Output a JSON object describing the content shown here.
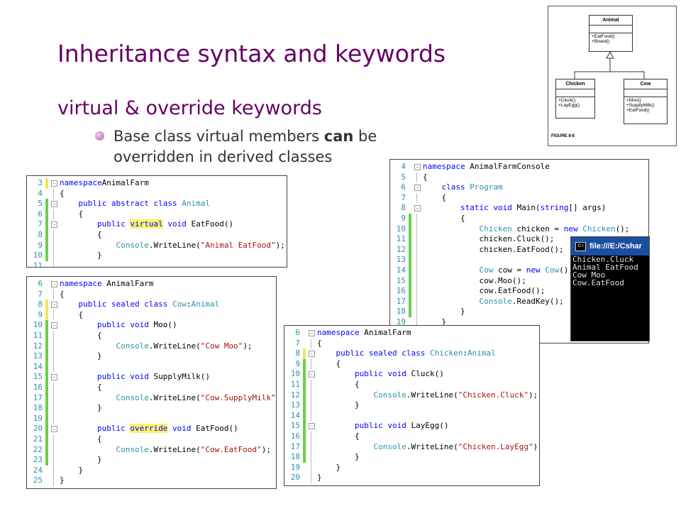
{
  "slide": {
    "title": "Inheritance syntax and keywords",
    "subtitle": "virtual & override keywords",
    "bullet_pre": "Base class virtual members ",
    "bullet_bold": "can",
    "bullet_post": " be overridden  in derived classes"
  },
  "uml": {
    "base": {
      "name": "Animal",
      "members": [
        "+EatFood()",
        "+Breed()"
      ]
    },
    "left": {
      "name": "Chicken",
      "members": [
        "+Cluck()",
        "+LayEgg()"
      ]
    },
    "right": {
      "name": "Cow",
      "members": [
        "+Moo()",
        "+SupplyMilk()",
        "+EatFood()"
      ]
    },
    "caption": "FIGURE 8-8"
  },
  "console": {
    "title": "file:///E:/Cshar",
    "icon": "C:\\",
    "lines": [
      "Chicken.Cluck",
      "Animal EatFood",
      "Cow Moo",
      "Cow.EatFood"
    ]
  },
  "snippets": [
    {
      "name": "animal-code-panel",
      "lines": [
        {
          "n": "3",
          "bar": "y",
          "fold": "-",
          "t": [
            [
              "kw",
              "namespace"
            ],
            [
              "",
              "AnimalFarm"
            ]
          ]
        },
        {
          "n": "4",
          "bar": "",
          "fold": "",
          "t": [
            [
              "",
              "{"
            ]
          ]
        },
        {
          "n": "5",
          "bar": "g",
          "fold": "-",
          "t": [
            [
              "",
              "    "
            ],
            [
              "kw",
              "public abstract class"
            ],
            [
              "",
              " "
            ],
            [
              "ty",
              "Animal"
            ]
          ]
        },
        {
          "n": "6",
          "bar": "g",
          "fold": "",
          "t": [
            [
              "",
              "    {"
            ]
          ]
        },
        {
          "n": "7",
          "bar": "g",
          "fold": "-",
          "t": [
            [
              "",
              "        "
            ],
            [
              "kw",
              "public"
            ],
            [
              "",
              " "
            ],
            [
              "kwhl",
              "virtual"
            ],
            [
              "",
              " "
            ],
            [
              "kw",
              "void"
            ],
            [
              "",
              " EatFood()"
            ]
          ]
        },
        {
          "n": "8",
          "bar": "g",
          "fold": "",
          "t": [
            [
              "",
              "        {"
            ]
          ]
        },
        {
          "n": "9",
          "bar": "g",
          "fold": "",
          "t": [
            [
              "",
              "            "
            ],
            [
              "ty",
              "Console"
            ],
            [
              "",
              ".WriteLine("
            ],
            [
              "st",
              "\"Animal EatFood\""
            ],
            [
              "",
              ");"
            ]
          ]
        },
        {
          "n": "10",
          "bar": "g",
          "fold": "",
          "t": [
            [
              "",
              "        }"
            ]
          ]
        },
        {
          "n": "11",
          "bar": "",
          "fold": "",
          "t": [
            [
              "",
              ""
            ]
          ]
        }
      ]
    },
    {
      "name": "cow-code-panel",
      "lines": [
        {
          "n": "6",
          "bar": "",
          "fold": "-",
          "t": [
            [
              "kw",
              "namespace"
            ],
            [
              "",
              " AnimalFarm"
            ]
          ]
        },
        {
          "n": "7",
          "bar": "",
          "fold": "",
          "t": [
            [
              "",
              "{"
            ]
          ]
        },
        {
          "n": "8",
          "bar": "y",
          "fold": "-",
          "t": [
            [
              "",
              "    "
            ],
            [
              "kw",
              "public sealed class"
            ],
            [
              "",
              " "
            ],
            [
              "ty",
              "Cow"
            ],
            [
              "",
              ":"
            ],
            [
              "ty",
              "Animal"
            ]
          ]
        },
        {
          "n": "9",
          "bar": "y",
          "fold": "",
          "t": [
            [
              "",
              "    {"
            ]
          ]
        },
        {
          "n": "10",
          "bar": "g",
          "fold": "-",
          "t": [
            [
              "",
              "        "
            ],
            [
              "kw",
              "public void"
            ],
            [
              "",
              " Moo()"
            ]
          ]
        },
        {
          "n": "11",
          "bar": "g",
          "fold": "",
          "t": [
            [
              "",
              "        {"
            ]
          ]
        },
        {
          "n": "12",
          "bar": "g",
          "fold": "",
          "t": [
            [
              "",
              "            "
            ],
            [
              "ty",
              "Console"
            ],
            [
              "",
              ".WriteLine("
            ],
            [
              "st",
              "\"Cow Moo\""
            ],
            [
              "",
              ");"
            ]
          ]
        },
        {
          "n": "13",
          "bar": "g",
          "fold": "",
          "t": [
            [
              "",
              "        }"
            ]
          ]
        },
        {
          "n": "14",
          "bar": "g",
          "fold": "",
          "t": [
            [
              "",
              ""
            ]
          ]
        },
        {
          "n": "15",
          "bar": "g",
          "fold": "-",
          "t": [
            [
              "",
              "        "
            ],
            [
              "kw",
              "public void"
            ],
            [
              "",
              " SupplyMilk()"
            ]
          ]
        },
        {
          "n": "16",
          "bar": "g",
          "fold": "",
          "t": [
            [
              "",
              "        {"
            ]
          ]
        },
        {
          "n": "17",
          "bar": "g",
          "fold": "",
          "t": [
            [
              "",
              "            "
            ],
            [
              "ty",
              "Console"
            ],
            [
              "",
              ".WriteLine("
            ],
            [
              "st",
              "\"Cow.SupplyMilk\""
            ],
            [
              "",
              ");"
            ]
          ]
        },
        {
          "n": "18",
          "bar": "g",
          "fold": "",
          "t": [
            [
              "",
              "        }"
            ]
          ]
        },
        {
          "n": "19",
          "bar": "g",
          "fold": "",
          "t": [
            [
              "",
              ""
            ]
          ]
        },
        {
          "n": "20",
          "bar": "g",
          "fold": "-",
          "t": [
            [
              "",
              "        "
            ],
            [
              "kw",
              "public"
            ],
            [
              "",
              " "
            ],
            [
              "kwhl",
              "override"
            ],
            [
              "",
              " "
            ],
            [
              "kw",
              "void"
            ],
            [
              "",
              " EatFood()"
            ]
          ]
        },
        {
          "n": "21",
          "bar": "g",
          "fold": "",
          "t": [
            [
              "",
              "        {"
            ]
          ]
        },
        {
          "n": "22",
          "bar": "g",
          "fold": "",
          "t": [
            [
              "",
              "            "
            ],
            [
              "ty",
              "Console"
            ],
            [
              "",
              ".WriteLine("
            ],
            [
              "st",
              "\"Cow.EatFood\""
            ],
            [
              "",
              ");"
            ]
          ]
        },
        {
          "n": "23",
          "bar": "g",
          "fold": "",
          "t": [
            [
              "",
              "        }"
            ]
          ]
        },
        {
          "n": "24",
          "bar": "",
          "fold": "",
          "t": [
            [
              "",
              "    }"
            ]
          ]
        },
        {
          "n": "25",
          "bar": "",
          "fold": "",
          "t": [
            [
              "",
              "}"
            ]
          ]
        }
      ]
    },
    {
      "name": "program-code-panel",
      "lines": [
        {
          "n": "4",
          "bar": "",
          "fold": "-",
          "t": [
            [
              "kw",
              "namespace"
            ],
            [
              "",
              " AnimalFarmConsole"
            ]
          ]
        },
        {
          "n": "5",
          "bar": "",
          "fold": "",
          "t": [
            [
              "",
              "{"
            ]
          ]
        },
        {
          "n": "6",
          "bar": "",
          "fold": "-",
          "t": [
            [
              "",
              "    "
            ],
            [
              "kw",
              "class"
            ],
            [
              "",
              " "
            ],
            [
              "ty",
              "Program"
            ]
          ]
        },
        {
          "n": "7",
          "bar": "",
          "fold": "",
          "t": [
            [
              "",
              "    {"
            ]
          ]
        },
        {
          "n": "8",
          "bar": "",
          "fold": "-",
          "t": [
            [
              "",
              "        "
            ],
            [
              "kw",
              "static void"
            ],
            [
              "",
              " Main("
            ],
            [
              "kw",
              "string"
            ],
            [
              "",
              "[] args)"
            ]
          ]
        },
        {
          "n": "9",
          "bar": "g",
          "fold": "",
          "t": [
            [
              "",
              "        {"
            ]
          ]
        },
        {
          "n": "10",
          "bar": "g",
          "fold": "",
          "t": [
            [
              "",
              "            "
            ],
            [
              "ty",
              "Chicken"
            ],
            [
              "",
              " chicken = "
            ],
            [
              "kw",
              "new"
            ],
            [
              "",
              " "
            ],
            [
              "ty",
              "Chicken"
            ],
            [
              "",
              "();"
            ]
          ]
        },
        {
          "n": "11",
          "bar": "g",
          "fold": "",
          "t": [
            [
              "",
              "            chicken.Cluck();"
            ]
          ]
        },
        {
          "n": "12",
          "bar": "g",
          "fold": "",
          "t": [
            [
              "",
              "            chicken.EatFood();"
            ]
          ]
        },
        {
          "n": "13",
          "bar": "g",
          "fold": "",
          "t": [
            [
              "",
              ""
            ]
          ]
        },
        {
          "n": "14",
          "bar": "g",
          "fold": "",
          "t": [
            [
              "",
              "            "
            ],
            [
              "ty",
              "Cow"
            ],
            [
              "",
              " cow = "
            ],
            [
              "kw",
              "new"
            ],
            [
              "",
              " "
            ],
            [
              "ty",
              "Cow"
            ],
            [
              "",
              "();"
            ]
          ]
        },
        {
          "n": "15",
          "bar": "g",
          "fold": "",
          "t": [
            [
              "",
              "            cow.Moo();"
            ]
          ]
        },
        {
          "n": "16",
          "bar": "g",
          "fold": "",
          "t": [
            [
              "",
              "            cow.EatFood();"
            ]
          ]
        },
        {
          "n": "17",
          "bar": "g",
          "fold": "",
          "t": [
            [
              "",
              "            "
            ],
            [
              "ty",
              "Console"
            ],
            [
              "",
              ".ReadKey();"
            ]
          ]
        },
        {
          "n": "18",
          "bar": "g",
          "fold": "",
          "t": [
            [
              "",
              "        }"
            ]
          ]
        },
        {
          "n": "19",
          "bar": "",
          "fold": "",
          "t": [
            [
              "",
              "    }"
            ]
          ]
        }
      ]
    },
    {
      "name": "chicken-code-panel",
      "lines": [
        {
          "n": "6",
          "bar": "",
          "fold": "-",
          "t": [
            [
              "kw",
              "namespace"
            ],
            [
              "",
              " AnimalFarm"
            ]
          ]
        },
        {
          "n": "7",
          "bar": "",
          "fold": "",
          "t": [
            [
              "",
              "{"
            ]
          ]
        },
        {
          "n": "8",
          "bar": "y",
          "fold": "-",
          "t": [
            [
              "",
              "    "
            ],
            [
              "kw",
              "public sealed class"
            ],
            [
              "",
              " "
            ],
            [
              "ty",
              "Chicken"
            ],
            [
              "",
              ":"
            ],
            [
              "ty",
              "Animal"
            ]
          ]
        },
        {
          "n": "9",
          "bar": "g",
          "fold": "",
          "t": [
            [
              "",
              "    {"
            ]
          ]
        },
        {
          "n": "10",
          "bar": "g",
          "fold": "-",
          "t": [
            [
              "",
              "        "
            ],
            [
              "kw",
              "public void"
            ],
            [
              "",
              " Cluck()"
            ]
          ]
        },
        {
          "n": "11",
          "bar": "g",
          "fold": "",
          "t": [
            [
              "",
              "        {"
            ]
          ]
        },
        {
          "n": "12",
          "bar": "g",
          "fold": "",
          "t": [
            [
              "",
              "            "
            ],
            [
              "ty",
              "Console"
            ],
            [
              "",
              ".WriteLine("
            ],
            [
              "st",
              "\"Chicken.Cluck\""
            ],
            [
              "",
              ");"
            ]
          ]
        },
        {
          "n": "13",
          "bar": "g",
          "fold": "",
          "t": [
            [
              "",
              "        }"
            ]
          ]
        },
        {
          "n": "14",
          "bar": "g",
          "fold": "",
          "t": [
            [
              "",
              ""
            ]
          ]
        },
        {
          "n": "15",
          "bar": "g",
          "fold": "-",
          "t": [
            [
              "",
              "        "
            ],
            [
              "kw",
              "public void"
            ],
            [
              "",
              " LayEgg()"
            ]
          ]
        },
        {
          "n": "16",
          "bar": "g",
          "fold": "",
          "t": [
            [
              "",
              "        {"
            ]
          ]
        },
        {
          "n": "17",
          "bar": "g",
          "fold": "",
          "t": [
            [
              "",
              "            "
            ],
            [
              "ty",
              "Console"
            ],
            [
              "",
              ".WriteLine("
            ],
            [
              "st",
              "\"Chicken.LayEgg\""
            ],
            [
              "",
              ");"
            ]
          ]
        },
        {
          "n": "18",
          "bar": "g",
          "fold": "",
          "t": [
            [
              "",
              "        }"
            ]
          ]
        },
        {
          "n": "19",
          "bar": "",
          "fold": "",
          "t": [
            [
              "",
              "    }"
            ]
          ]
        },
        {
          "n": "20",
          "bar": "",
          "fold": "",
          "t": [
            [
              "",
              "}"
            ]
          ]
        }
      ]
    }
  ]
}
